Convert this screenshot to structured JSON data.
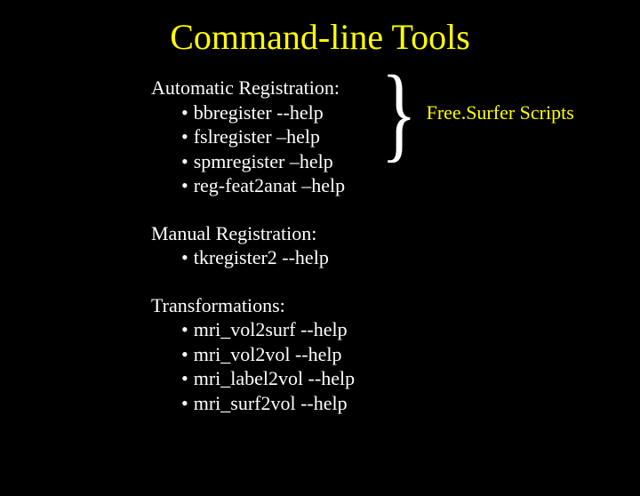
{
  "title": "Command-line Tools",
  "sections": [
    {
      "heading": "Automatic Registration:",
      "items": [
        "bbregister --help",
        "fslregister –help",
        "spmregister –help",
        "reg-feat2anat –help"
      ]
    },
    {
      "heading": "Manual Registration:",
      "items": [
        "tkregister2 --help"
      ]
    },
    {
      "heading": "Transformations:",
      "items": [
        "mri_vol2surf --help",
        "mri_vol2vol --help",
        "mri_label2vol --help",
        "mri_surf2vol --help"
      ]
    }
  ],
  "annotation": "Free.Surfer Scripts",
  "bullet": "•"
}
